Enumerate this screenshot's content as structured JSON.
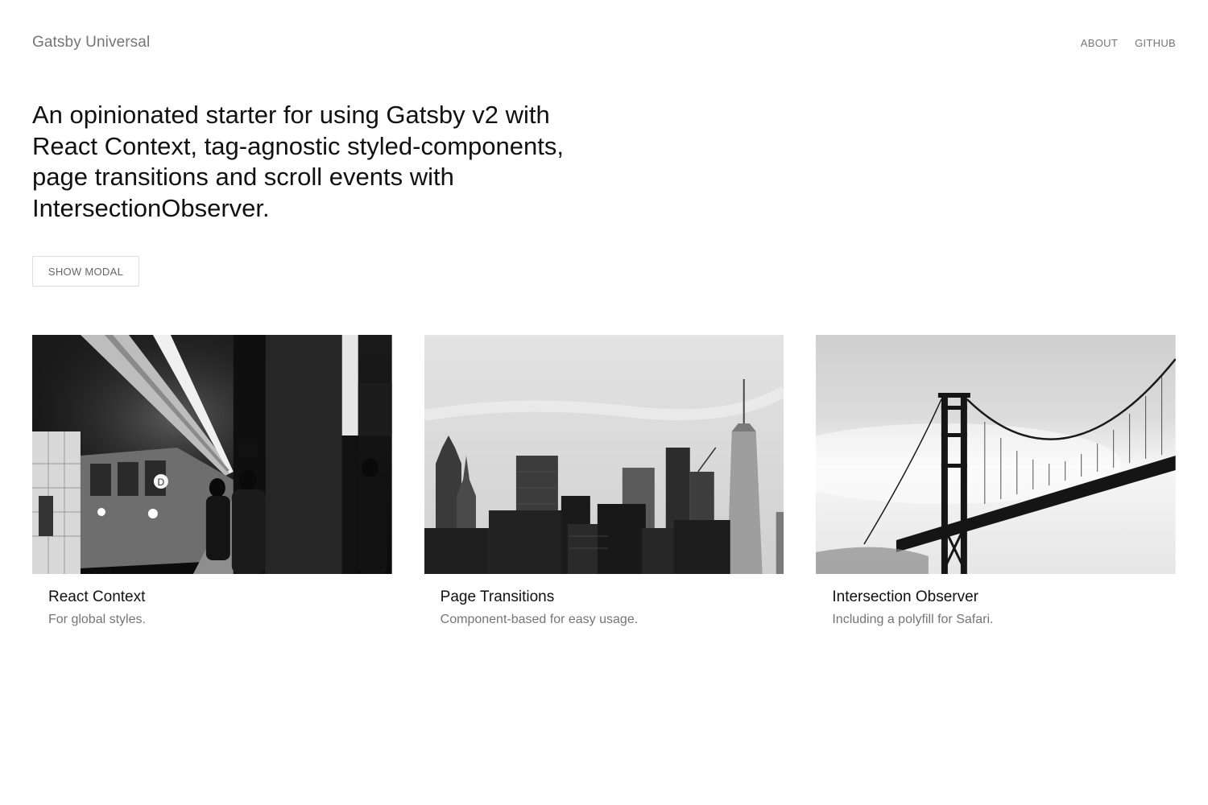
{
  "header": {
    "site_title": "Gatsby Universal",
    "nav": [
      {
        "label": "ABOUT"
      },
      {
        "label": "GITHUB"
      }
    ]
  },
  "intro": {
    "text": "An opinionated starter for using Gatsby v2 with React Context, tag-agnostic styled-components, page transitions and scroll events with IntersectionObserver."
  },
  "modal_button": {
    "label": "SHOW MODAL"
  },
  "cards": [
    {
      "title": "React Context",
      "description": "For global styles.",
      "image_icon": "subway-station-photo"
    },
    {
      "title": "Page Transitions",
      "description": "Component-based for easy usage.",
      "image_icon": "city-skyline-photo"
    },
    {
      "title": "Intersection Observer",
      "description": "Including a polyfill for Safari.",
      "image_icon": "suspension-bridge-photo"
    }
  ],
  "colors": {
    "muted_text": "#757575",
    "body_text": "#111111",
    "button_border": "#dcdcdc"
  }
}
